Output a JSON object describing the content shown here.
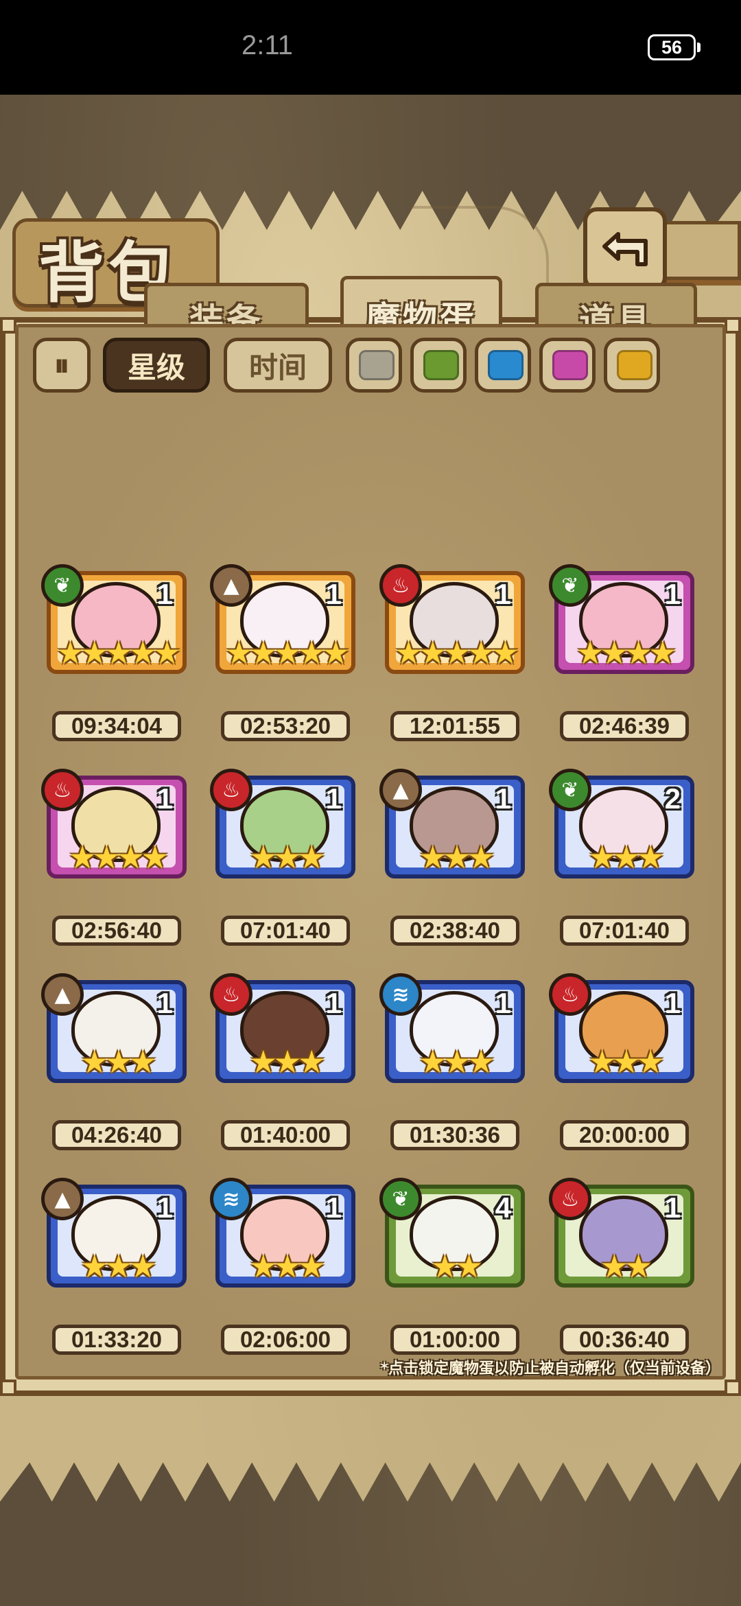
{
  "status_bar": {
    "time": "2:11",
    "battery": "56"
  },
  "header": {
    "title": "背包"
  },
  "tabs": [
    {
      "label": "装备",
      "active": false
    },
    {
      "label": "魔物蛋",
      "active": true
    },
    {
      "label": "道具",
      "active": false
    }
  ],
  "filters": {
    "sort_icon": "sort-toggle-icon",
    "star_label": "星级",
    "time_label": "时间",
    "color_swatches": [
      "#a8a290",
      "#6a9a30",
      "#2a8ad0",
      "#c84aa8",
      "#e0a820"
    ]
  },
  "eggs": [
    {
      "count": "1",
      "stars": "★★★★★",
      "timer": "09:34:04",
      "rarity": "orange",
      "element": "grass",
      "art": "#f6b8c4"
    },
    {
      "count": "1",
      "stars": "★★★★★",
      "timer": "02:53:20",
      "rarity": "orange",
      "element": "earth",
      "art": "#f8f0f4"
    },
    {
      "count": "1",
      "stars": "★★★★★",
      "timer": "12:01:55",
      "rarity": "orange",
      "element": "fire",
      "art": "#e8dede"
    },
    {
      "count": "1",
      "stars": "★★★★",
      "timer": "02:46:39",
      "rarity": "purple",
      "element": "grass",
      "art": "#f4b8c8"
    },
    {
      "count": "1",
      "stars": "★★★★",
      "timer": "02:56:40",
      "rarity": "purple",
      "element": "fire",
      "art": "#f0e0a8"
    },
    {
      "count": "1",
      "stars": "★★★",
      "timer": "07:01:40",
      "rarity": "blue",
      "element": "fire",
      "art": "#a8d088"
    },
    {
      "count": "1",
      "stars": "★★★",
      "timer": "02:38:40",
      "rarity": "blue",
      "element": "earth",
      "art": "#b89890"
    },
    {
      "count": "2",
      "stars": "★★★",
      "timer": "07:01:40",
      "rarity": "blue",
      "element": "grass",
      "art": "#f6e0e8"
    },
    {
      "count": "1",
      "stars": "★★★",
      "timer": "04:26:40",
      "rarity": "blue",
      "element": "earth",
      "art": "#f4f0ea"
    },
    {
      "count": "1",
      "stars": "★★★",
      "timer": "01:40:00",
      "rarity": "blue",
      "element": "fire",
      "art": "#6a4030"
    },
    {
      "count": "1",
      "stars": "★★★",
      "timer": "01:30:36",
      "rarity": "blue",
      "element": "water",
      "art": "#f2f4fa"
    },
    {
      "count": "1",
      "stars": "★★★",
      "timer": "20:00:00",
      "rarity": "blue",
      "element": "fire",
      "art": "#e8a050"
    },
    {
      "count": "1",
      "stars": "★★★",
      "timer": "01:33:20",
      "rarity": "blue",
      "element": "earth",
      "art": "#f6f2ea"
    },
    {
      "count": "1",
      "stars": "★★★",
      "timer": "02:06:00",
      "rarity": "blue",
      "element": "water",
      "art": "#f8c8c0"
    },
    {
      "count": "4",
      "stars": "★★",
      "timer": "01:00:00",
      "rarity": "green",
      "element": "grass",
      "art": "#f4f4ee"
    },
    {
      "count": "1",
      "stars": "★★",
      "timer": "00:36:40",
      "rarity": "green",
      "element": "fire",
      "art": "#a898d0"
    }
  ],
  "footnote": "*点击锁定魔物蛋以防止被自动孵化（仅当前设备）"
}
